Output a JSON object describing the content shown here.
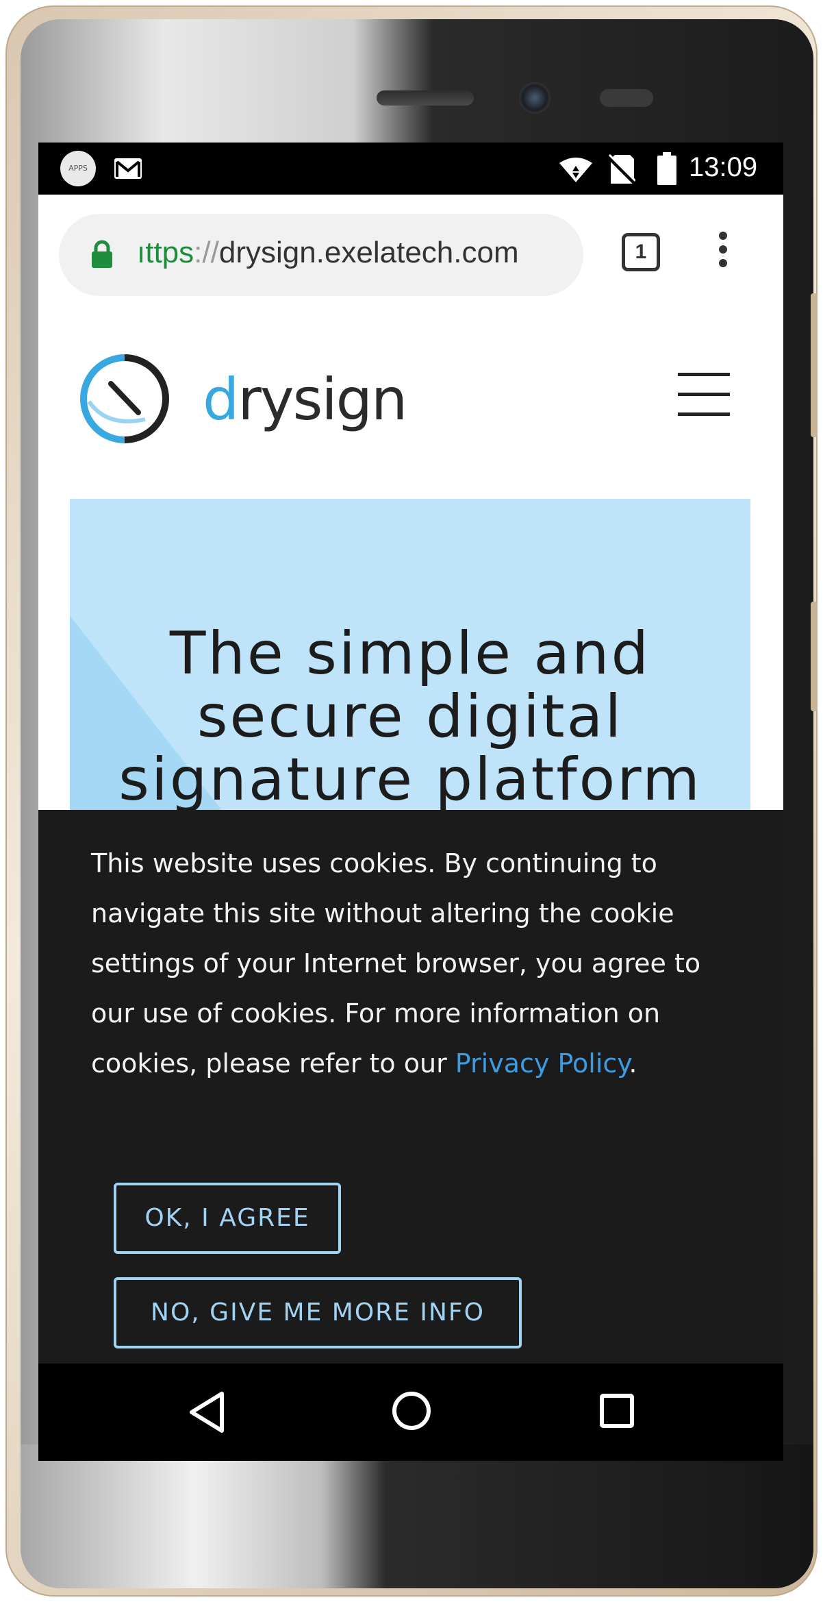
{
  "status_bar": {
    "time": "13:09",
    "apps_icon_label": "APPS",
    "icons": [
      "apps-icon",
      "gmail-icon",
      "wifi-icon",
      "no-sim-icon",
      "battery-icon"
    ]
  },
  "browser": {
    "url_scheme": "ıttps",
    "url_separator": "://",
    "url_host": "drysign.exelatech.com",
    "tab_count": "1",
    "lock_color": "#1e8e3e"
  },
  "site": {
    "logo_prefix": "d",
    "logo_rest": "rysign",
    "brand_color": "#3aa8e0"
  },
  "hero": {
    "title": "The simple and secure digital signature platform",
    "background": "#bfe4f9"
  },
  "cookie_banner": {
    "message": "This website uses cookies. By continuing to navigate this site without altering the cookie settings of your Internet browser, you agree to our use of cookies. For more information on cookies, please refer to our",
    "link_text": "Privacy Policy",
    "trailing": ".",
    "agree_label": "OK, I AGREE",
    "more_info_label": "NO, GIVE ME MORE INFO",
    "accent_color": "#a3d3f3"
  },
  "nav_bar": {
    "icons": [
      "back-icon",
      "home-icon",
      "recents-icon"
    ]
  }
}
